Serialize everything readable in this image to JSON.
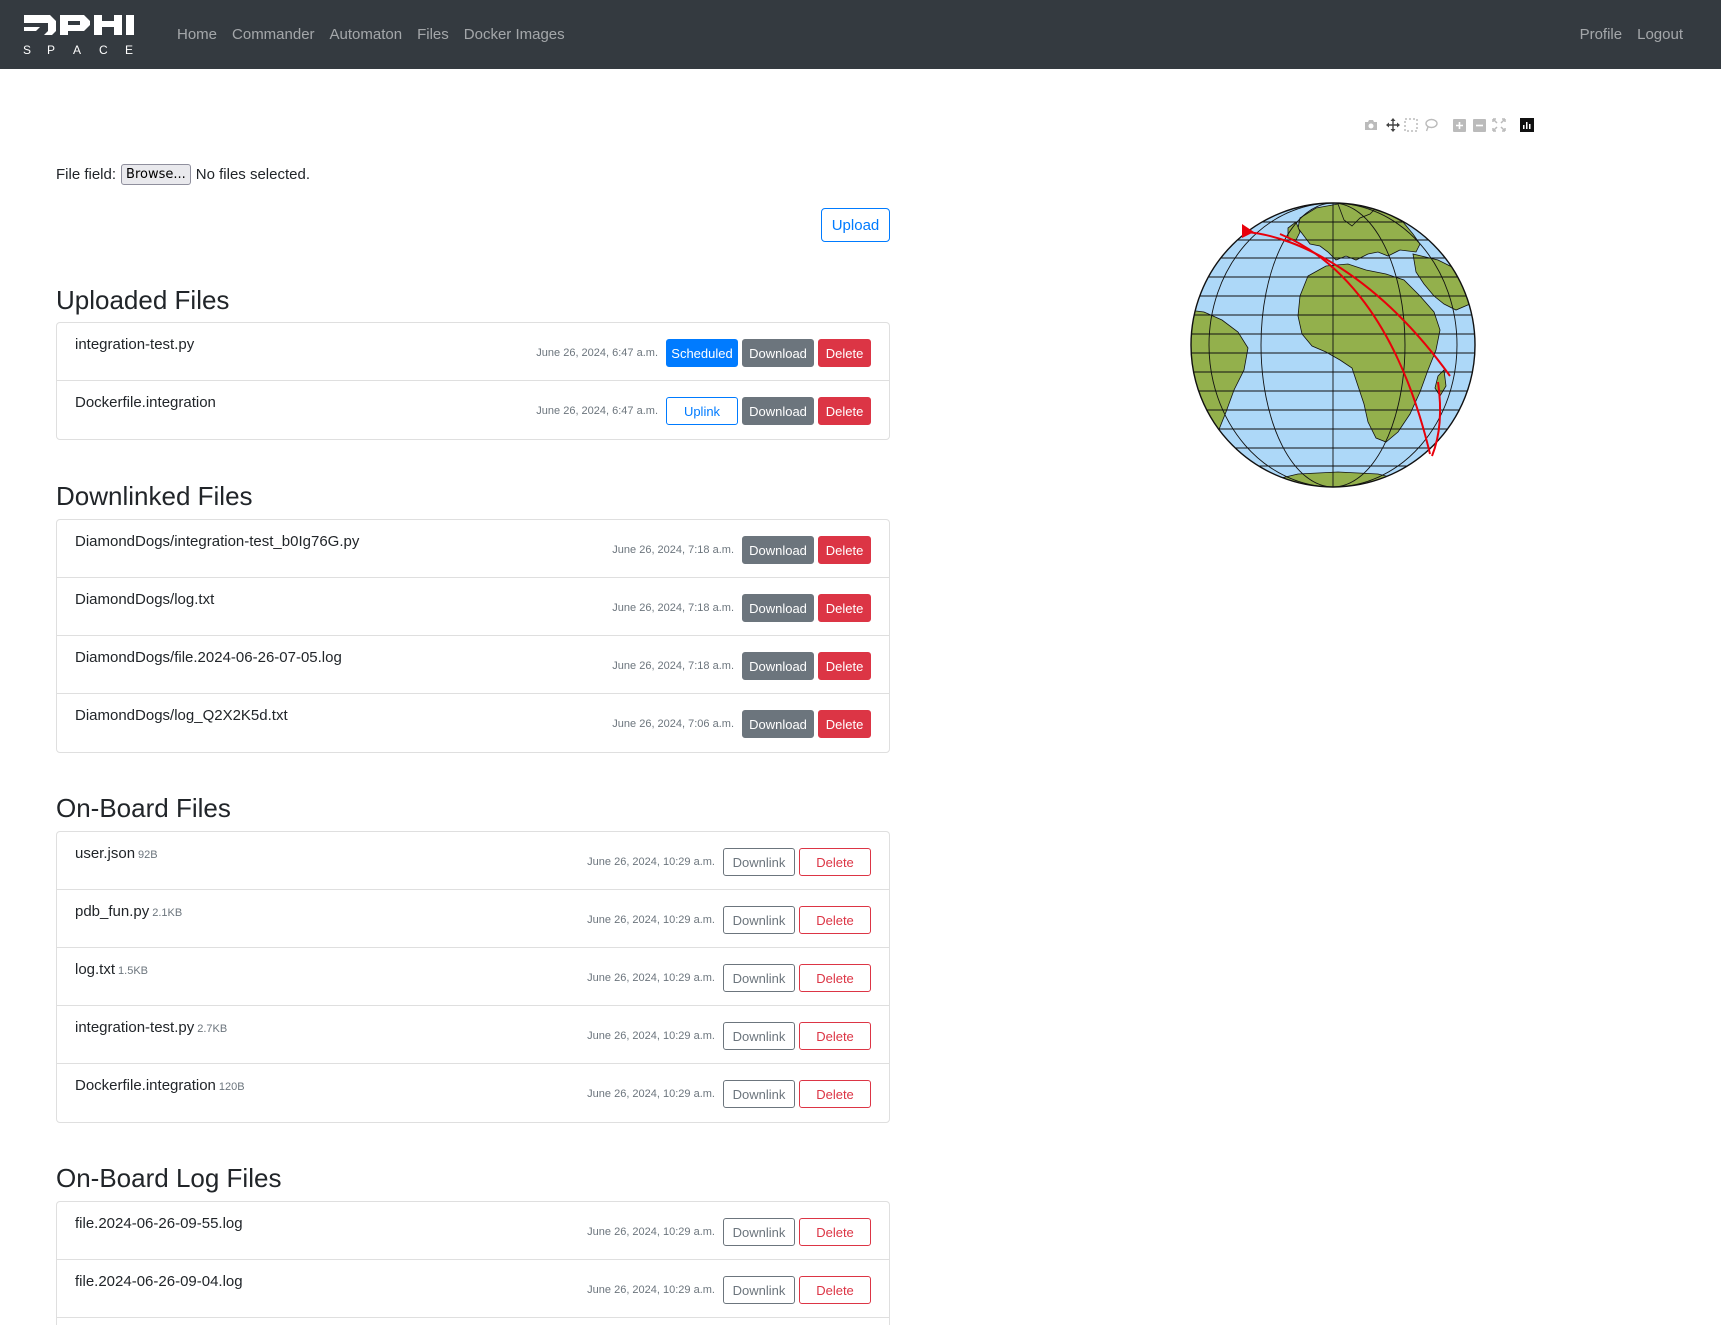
{
  "nav": {
    "links": [
      "Home",
      "Commander",
      "Automaton",
      "Files",
      "Docker Images"
    ],
    "right_links": [
      "Profile",
      "Logout"
    ],
    "logo_text": "DPHI SPACE"
  },
  "upload": {
    "field_label": "File field:",
    "browse_label": "Browse...",
    "status": "No files selected.",
    "upload_label": "Upload"
  },
  "uploaded": {
    "title": "Uploaded Files",
    "items": [
      {
        "name": "integration-test.py",
        "time": "June 26, 2024, 6:47 a.m.",
        "status_btn": "Scheduled",
        "download": "Download",
        "delete": "Delete"
      },
      {
        "name": "Dockerfile.integration",
        "time": "June 26, 2024, 6:47 a.m.",
        "status_btn": "Uplink",
        "download": "Download",
        "delete": "Delete"
      }
    ]
  },
  "downlinked": {
    "title": "Downlinked Files",
    "items": [
      {
        "name": "DiamondDogs/integration-test_b0Ig76G.py",
        "time": "June 26, 2024, 7:18 a.m.",
        "download": "Download",
        "delete": "Delete"
      },
      {
        "name": "DiamondDogs/log.txt",
        "time": "June 26, 2024, 7:18 a.m.",
        "download": "Download",
        "delete": "Delete"
      },
      {
        "name": "DiamondDogs/file.2024-06-26-07-05.log",
        "time": "June 26, 2024, 7:18 a.m.",
        "download": "Download",
        "delete": "Delete"
      },
      {
        "name": "DiamondDogs/log_Q2X2K5d.txt",
        "time": "June 26, 2024, 7:06 a.m.",
        "download": "Download",
        "delete": "Delete"
      }
    ]
  },
  "onboard": {
    "title": "On-Board Files",
    "items": [
      {
        "name": "user.json",
        "size": "92B",
        "time": "June 26, 2024, 10:29 a.m.",
        "downlink": "Downlink",
        "delete": "Delete"
      },
      {
        "name": "pdb_fun.py",
        "size": "2.1KB",
        "time": "June 26, 2024, 10:29 a.m.",
        "downlink": "Downlink",
        "delete": "Delete"
      },
      {
        "name": "log.txt",
        "size": "1.5KB",
        "time": "June 26, 2024, 10:29 a.m.",
        "downlink": "Downlink",
        "delete": "Delete"
      },
      {
        "name": "integration-test.py",
        "size": "2.7KB",
        "time": "June 26, 2024, 10:29 a.m.",
        "downlink": "Downlink",
        "delete": "Delete"
      },
      {
        "name": "Dockerfile.integration",
        "size": "120B",
        "time": "June 26, 2024, 10:29 a.m.",
        "downlink": "Downlink",
        "delete": "Delete"
      }
    ]
  },
  "onboard_logs": {
    "title": "On-Board Log Files",
    "items": [
      {
        "name": "file.2024-06-26-09-55.log",
        "time": "June 26, 2024, 10:29 a.m.",
        "downlink": "Downlink",
        "delete": "Delete"
      },
      {
        "name": "file.2024-06-26-09-04.log",
        "time": "June 26, 2024, 10:29 a.m.",
        "downlink": "Downlink",
        "delete": "Delete"
      }
    ]
  },
  "plot": {
    "modebar_icons": [
      "camera-icon",
      "pan-icon",
      "box-select-icon",
      "lasso-icon",
      "zoom-in-icon",
      "zoom-out-icon",
      "reset-icon",
      "plotly-logo-icon"
    ],
    "ocean_color": "#add8f8",
    "land_color": "#93b04c",
    "track_color": "#e8000b"
  }
}
